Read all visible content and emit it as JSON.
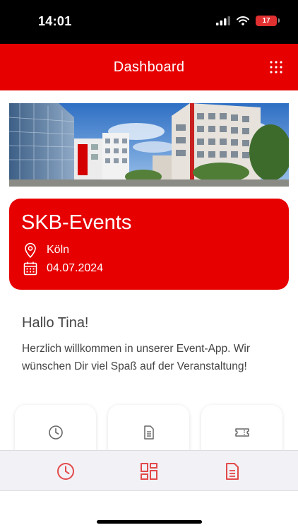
{
  "status_bar": {
    "time": "14:01",
    "battery": "17"
  },
  "header": {
    "title": "Dashboard"
  },
  "event": {
    "title": "SKB-Events",
    "location": "Köln",
    "date": "04.07.2024"
  },
  "greeting": {
    "title": "Hallo Tina!",
    "message": "Herzlich willkommen in unserer Event-App. Wir wünschen Dir viel Spaß auf der Veranstaltung!"
  },
  "tiles": [
    {
      "icon": "clock-icon"
    },
    {
      "icon": "document-icon"
    },
    {
      "icon": "ticket-icon"
    }
  ],
  "tab_bar": {
    "tabs": [
      {
        "icon": "clock-icon"
      },
      {
        "icon": "dashboard-grid-icon",
        "active": true
      },
      {
        "icon": "document-icon"
      }
    ]
  },
  "colors": {
    "brand_red": "#e60000",
    "icon_gray": "#666666",
    "tab_icon_red": "#e24a4a"
  }
}
